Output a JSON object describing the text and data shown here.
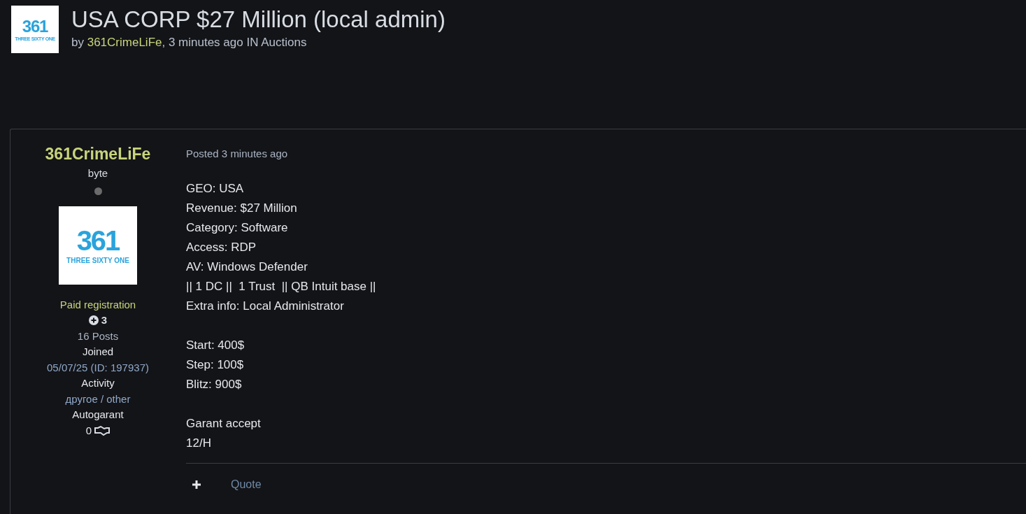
{
  "header": {
    "logo": {
      "number": "361",
      "tagline": "THREE SIXTY ONE"
    },
    "title": "USA CORP $27 Million (local admin)",
    "by": "by",
    "author": "361CrimeLiFe",
    "meta": ", 3 minutes ago IN Auctions"
  },
  "post": {
    "author": {
      "name": "361CrimeLiFe",
      "rank": "byte",
      "online": false,
      "avatar": {
        "number": "361",
        "tagline": "THREE SIXTY ONE"
      },
      "group": "Paid registration",
      "reputation": "3",
      "posts": "16 Posts",
      "joined_label": "Joined",
      "joined": "05/07/25 (ID: 197937)",
      "activity_label": "Activity",
      "activity": "другое / other",
      "autogarant_label": "Autogarant",
      "autogarant": "0"
    },
    "posted": "Posted 3 minutes ago",
    "paragraphs": [
      [
        "GEO: USA",
        "Revenue: $27 Million",
        "Category: Software",
        "Access: RDP",
        "AV: Windows Defender",
        "|| 1 DC ||  1 Trust  || QB Intuit base ||",
        "Extra info: Local Administrator"
      ],
      [
        "Start: 400$",
        "Step: 100$",
        "Blitz: 900$"
      ],
      [
        "Garant accept",
        "12/H"
      ]
    ],
    "actions": [
      {
        "kind": "plus"
      },
      {
        "kind": "link",
        "label": "Quote"
      }
    ]
  }
}
